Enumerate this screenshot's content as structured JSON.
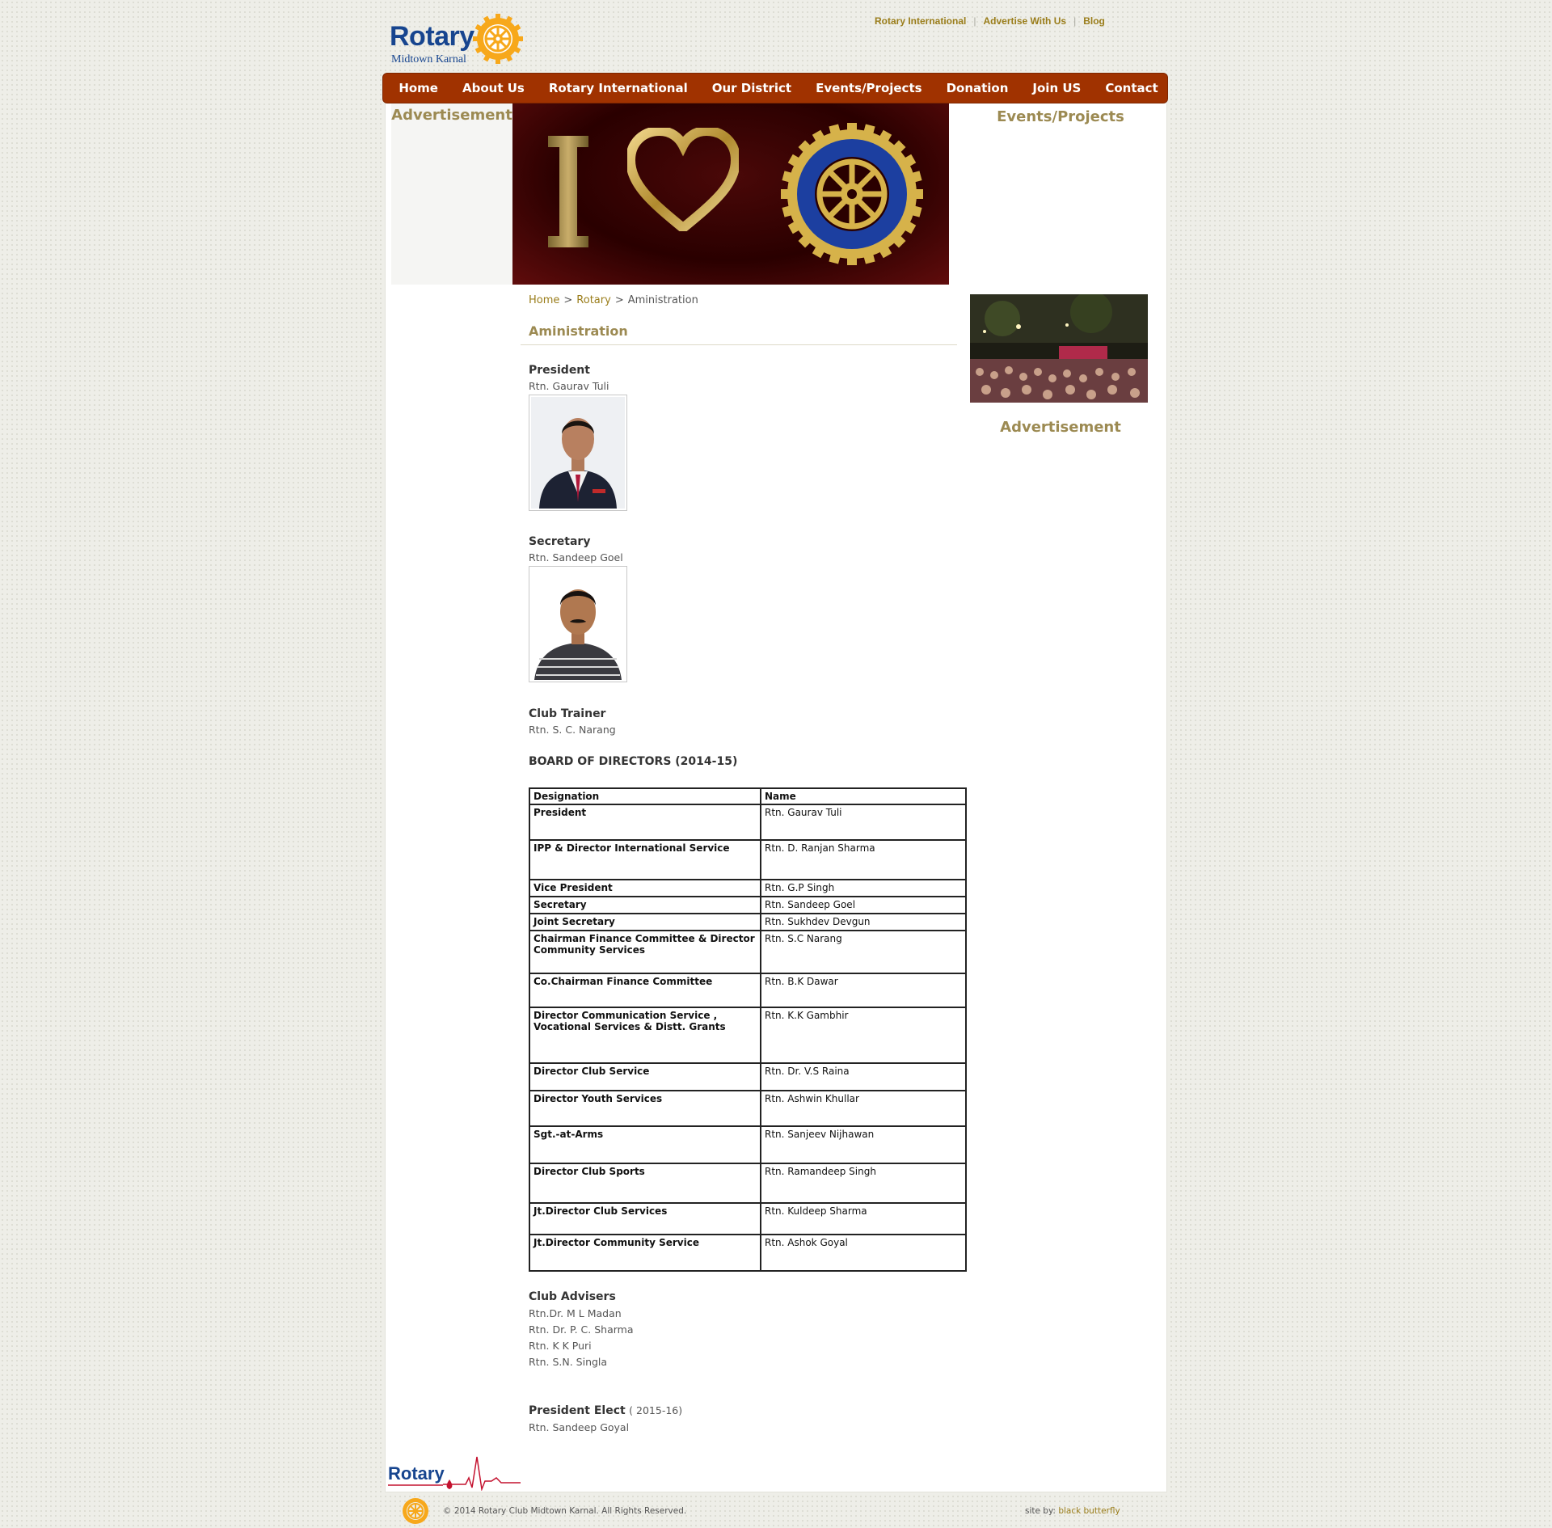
{
  "header": {
    "logo_word": "Rotary",
    "logo_sub": "Midtown Karnal",
    "top_links": [
      "Rotary International",
      "Advertise With Us",
      "Blog"
    ],
    "top_link_separator": "|"
  },
  "nav": {
    "items": [
      "Home",
      "About Us",
      "Rotary International",
      "Our District",
      "Events/Projects",
      "Donation",
      "Join US",
      "Contact"
    ]
  },
  "sidebar_left": {
    "title": "Advertisement"
  },
  "sidebar_right": {
    "events_title": "Events/Projects",
    "ad_title": "Advertisement"
  },
  "breadcrumb": {
    "items": [
      "Home",
      "Rotary",
      "Aministration"
    ],
    "separator": ">"
  },
  "page": {
    "title": "Aministration",
    "officers": [
      {
        "role": "President",
        "name": "Rtn. Gaurav Tuli"
      },
      {
        "role": "Secretary",
        "name": "Rtn. Sandeep Goel"
      },
      {
        "role": "Club Trainer",
        "name": "Rtn. S. C. Narang"
      }
    ],
    "board_title": "BOARD OF DIRECTORS (2014-15)",
    "board_headers": [
      "Designation",
      "Name"
    ],
    "board_rows": [
      {
        "designation": "President",
        "name": "Rtn. Gaurav Tuli"
      },
      {
        "designation": "IPP & Director International Service",
        "name": "Rtn. D. Ranjan Sharma"
      },
      {
        "designation": "Vice President",
        "name": "Rtn. G.P Singh"
      },
      {
        "designation": "Secretary",
        "name": "Rtn. Sandeep Goel"
      },
      {
        "designation": "Joint Secretary",
        "name": "Rtn. Sukhdev Devgun"
      },
      {
        "designation": "Chairman Finance Committee & Director Community Services",
        "name": "Rtn. S.C Narang"
      },
      {
        "designation": "Co.Chairman Finance Committee",
        "name": "Rtn. B.K Dawar"
      },
      {
        "designation": "Director Communication Service , Vocational Services & Distt. Grants",
        "name": "Rtn. K.K Gambhir"
      },
      {
        "designation": "Director Club Service",
        "name": "Rtn. Dr. V.S Raina"
      },
      {
        "designation": "Director Youth Services",
        "name": "Rtn. Ashwin Khullar"
      },
      {
        "designation": "Sgt.-at-Arms",
        "name": "Rtn. Sanjeev Nijhawan"
      },
      {
        "designation": "Director Club Sports",
        "name": "Rtn. Ramandeep Singh"
      },
      {
        "designation": "Jt.Director Club Services",
        "name": "Rtn. Kuldeep Sharma"
      },
      {
        "designation": "Jt.Director Community Service",
        "name": "Rtn. Ashok Goyal"
      }
    ],
    "advisers_title": "Club Advisers",
    "advisers": [
      "Rtn.Dr. M L Madan",
      "Rtn. Dr. P. C. Sharma",
      "Rtn. K K Puri",
      "Rtn. S.N. Singla"
    ],
    "president_elect_title": "President Elect",
    "president_elect_year": "( 2015-16)",
    "president_elect_name": "Rtn. Sandeep Goyal"
  },
  "footer": {
    "logo_word": "Rotary",
    "copyright": "© 2014 Rotary Club Midtown Karnal. All Rights Reserved.",
    "credit_prefix": "site by:",
    "credit_link": "black butterfly"
  },
  "colors": {
    "nav_bg": "#a03200",
    "accent_gold": "#9a7d1a",
    "section_title": "#9c8a52",
    "rotary_blue": "#17458f",
    "rotary_gold": "#f7a81b"
  }
}
